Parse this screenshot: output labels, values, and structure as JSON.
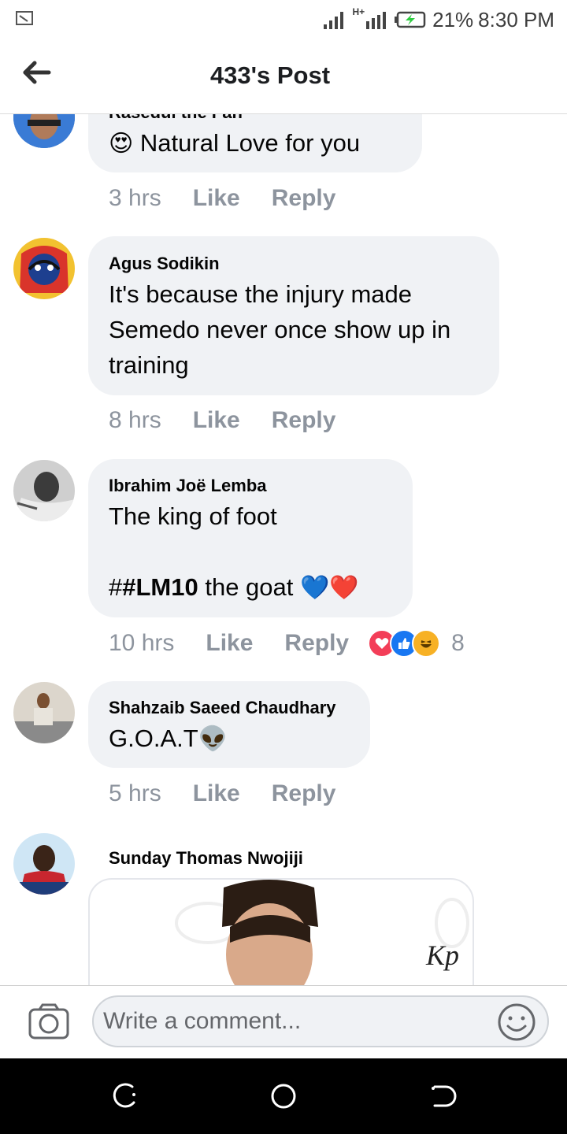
{
  "status_bar": {
    "network_label": "H+",
    "battery_percent": "21%",
    "time": "8:30 PM"
  },
  "header": {
    "title": "433's Post",
    "back_icon": "arrow-left-icon"
  },
  "comments": [
    {
      "author": "Rasedul the Fan",
      "text_emoji": "😍",
      "text": "Natural Love for you",
      "time": "3 hrs",
      "like_label": "Like",
      "reply_label": "Reply"
    },
    {
      "author": "Agus Sodikin",
      "lines": [
        "It's because the injury made",
        "Semedo never once show up in",
        "training"
      ],
      "time": "8 hrs",
      "like_label": "Like",
      "reply_label": "Reply"
    },
    {
      "author": "Ibrahim Joë Lemba",
      "line1": "The king of foot",
      "hash_prefix": "#",
      "hashtag": "#LM10",
      "line3_rest": " the goat",
      "emojis": "💙❤️",
      "time": "10 hrs",
      "like_label": "Like",
      "reply_label": "Reply",
      "reaction_count": "8",
      "reactions": [
        "love-reaction-icon",
        "like-reaction-icon",
        "haha-reaction-icon"
      ]
    },
    {
      "author": "Shahzaib Saeed Chaudhary",
      "text": "G.O.A.T",
      "text_emoji": "👽",
      "time": "5 hrs",
      "like_label": "Like",
      "reply_label": "Reply"
    },
    {
      "author": "Sunday Thomas Nwojiji",
      "attachment_mark": "Kp"
    }
  ],
  "composer": {
    "placeholder": "Write a comment...",
    "camera_icon": "camera-icon",
    "emoji_icon": "smiley-icon"
  },
  "nav_bar": {
    "icons": [
      "recent-apps-icon",
      "home-icon",
      "back-icon"
    ]
  },
  "colors": {
    "bubble": "#f0f2f5",
    "meta_text": "#8d949e",
    "love": "#f33e58",
    "like": "#1877f2",
    "haha": "#f7b125"
  }
}
